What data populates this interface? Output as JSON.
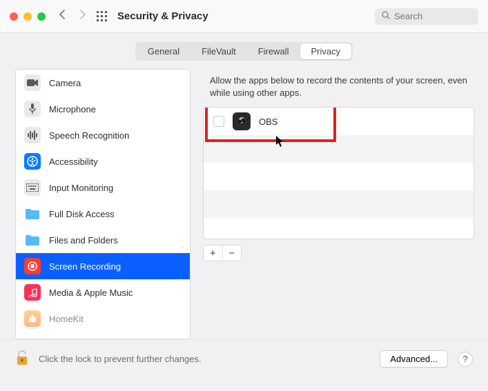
{
  "toolbar": {
    "title": "Security & Privacy",
    "search_placeholder": "Search"
  },
  "tabs": {
    "t0": "General",
    "t1": "FileVault",
    "t2": "Firewall",
    "t3": "Privacy"
  },
  "sidebar": {
    "items": [
      {
        "label": "Camera"
      },
      {
        "label": "Microphone"
      },
      {
        "label": "Speech Recognition"
      },
      {
        "label": "Accessibility"
      },
      {
        "label": "Input Monitoring"
      },
      {
        "label": "Full Disk Access"
      },
      {
        "label": "Files and Folders"
      },
      {
        "label": "Screen Recording"
      },
      {
        "label": "Media & Apple Music"
      },
      {
        "label": "HomeKit"
      }
    ]
  },
  "detail": {
    "description": "Allow the apps below to record the contents of your screen, even while using other apps.",
    "apps": [
      {
        "name": "OBS"
      }
    ],
    "add": "+",
    "remove": "−"
  },
  "footer": {
    "lock_text": "Click the lock to prevent further changes.",
    "advanced": "Advanced...",
    "help": "?"
  }
}
